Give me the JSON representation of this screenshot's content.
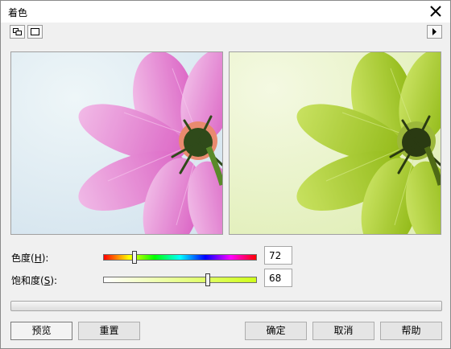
{
  "window": {
    "title": "着色"
  },
  "toolbar": {
    "dual_view_icon": "dual-preview-icon",
    "single_view_icon": "single-preview-icon",
    "expand_icon": "play-arrow-icon"
  },
  "hue": {
    "label": "色度(",
    "mnemonic": "H",
    "label_end": "):",
    "value": "72",
    "level": 0.2
  },
  "saturation": {
    "label": "饱和度(",
    "mnemonic": "S",
    "label_end": "):",
    "value": "68",
    "level": 0.68
  },
  "buttons": {
    "preview": "预览",
    "reset": "重置",
    "ok": "确定",
    "cancel": "取消",
    "help": "帮助"
  },
  "colors": {
    "original_bg": "#e2eef4",
    "original_petal": "#e77fd0",
    "tinted_bg": "#eef6cf",
    "tinted_petal": "#a7cc18",
    "flower_center": "#2f4a1a"
  }
}
